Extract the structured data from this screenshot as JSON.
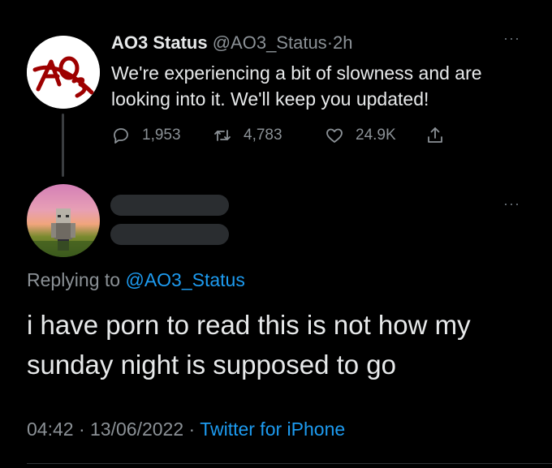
{
  "parent_tweet": {
    "display_name": "AO3 Status",
    "handle": "@AO3_Status",
    "separator": "·",
    "time": "2h",
    "text": "We're experiencing a bit of slowness and are looking into it. We'll keep you updated!",
    "replies": "1,953",
    "retweets": "4,783",
    "likes": "24.9K",
    "more_label": "···"
  },
  "reply_tweet": {
    "replying_prefix": "Replying to",
    "replying_to": "@AO3_Status",
    "text": "i have porn to read this is not how my sunday night is supposed to go",
    "time": "04:42",
    "separator": "·",
    "date": "13/06/2022",
    "source": "Twitter for iPhone",
    "more_label": "···"
  },
  "icons": {
    "reply": "reply-icon",
    "retweet": "retweet-icon",
    "like": "heart-icon",
    "share": "share-icon"
  },
  "colors": {
    "background": "#000000",
    "text": "#e7e9ea",
    "muted": "#8b9196",
    "link": "#1d9bf0",
    "ao3_red": "#9e0000"
  }
}
